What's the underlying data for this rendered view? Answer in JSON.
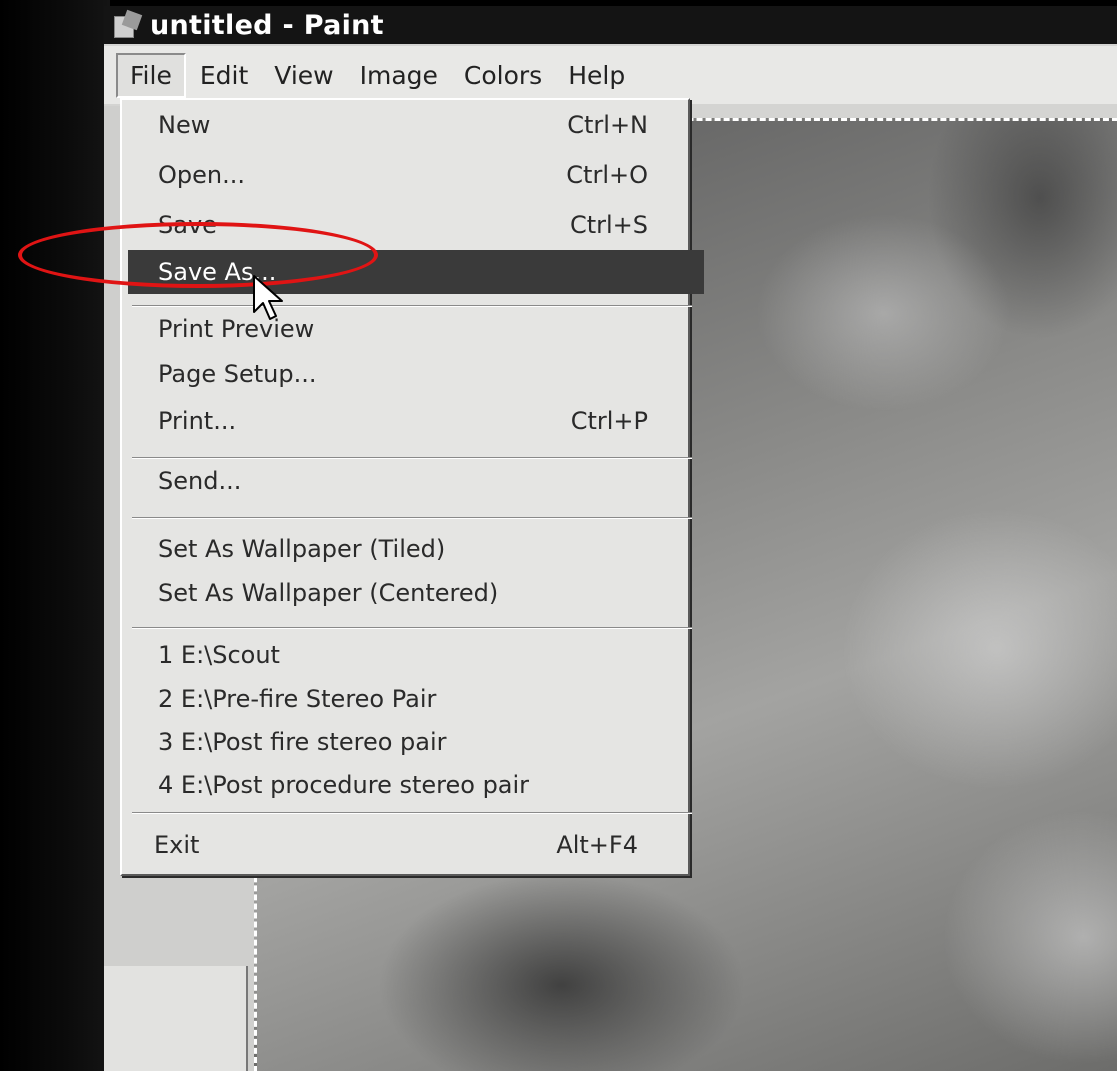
{
  "window": {
    "title": "untitled - Paint"
  },
  "menubar": {
    "items": [
      "File",
      "Edit",
      "View",
      "Image",
      "Colors",
      "Help"
    ]
  },
  "file_menu": {
    "items": [
      {
        "label": "New",
        "shortcut": "Ctrl+N"
      },
      {
        "label": "Open...",
        "shortcut": "Ctrl+O"
      },
      {
        "label": "Save",
        "shortcut": "Ctrl+S"
      },
      {
        "label": "Save As...",
        "shortcut": "",
        "highlighted": true
      },
      {
        "label": "Print Preview",
        "shortcut": ""
      },
      {
        "label": "Page Setup...",
        "shortcut": ""
      },
      {
        "label": "Print...",
        "shortcut": "Ctrl+P"
      },
      {
        "label": "Send...",
        "shortcut": ""
      },
      {
        "label": "Set As Wallpaper (Tiled)",
        "shortcut": ""
      },
      {
        "label": "Set As Wallpaper (Centered)",
        "shortcut": ""
      },
      {
        "label": "1 E:\\Scout",
        "shortcut": ""
      },
      {
        "label": "2 E:\\Pre-fire Stereo Pair",
        "shortcut": ""
      },
      {
        "label": "3 E:\\Post fire stereo pair",
        "shortcut": ""
      },
      {
        "label": "4 E:\\Post procedure stereo pair",
        "shortcut": ""
      },
      {
        "label": "Exit",
        "shortcut": "Alt+F4"
      }
    ]
  },
  "colors": {
    "highlight": "#3a3a3a",
    "annotation": "#e01414",
    "titlebar": "#141414"
  }
}
